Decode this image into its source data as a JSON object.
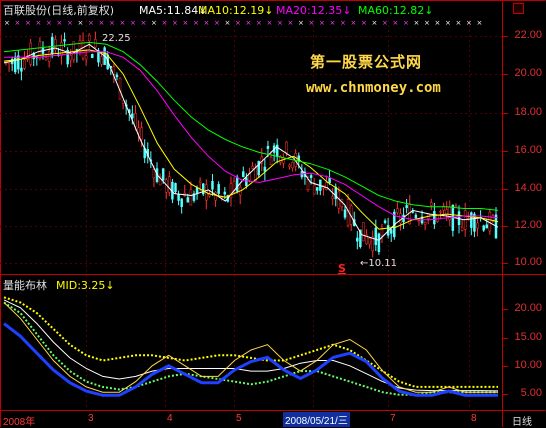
{
  "header": {
    "stock_name": "百联股份(日线,前复权)",
    "ma5": "MA5:11.84↓",
    "ma10": "MA10:12.19↓",
    "ma20": "MA20:12.35↓",
    "ma60": "MA60:12.82↓"
  },
  "watermark": {
    "line1": "第一股票公式网",
    "line2": "www.chnmoney.com"
  },
  "price_panel": {
    "high_label": "22.25",
    "low_label": "←10.11",
    "signal_mark": "S",
    "y_ticks": [
      "22.00",
      "20.00",
      "18.00",
      "16.00",
      "14.00",
      "12.00",
      "10.00"
    ]
  },
  "indicator_panel": {
    "name": "量能布林",
    "mid": "MID:3.25↓",
    "y_ticks": [
      "20.00",
      "15.00",
      "10.00",
      "5.00"
    ]
  },
  "x_axis": {
    "labels": [
      "2008年",
      "3",
      "4",
      "5",
      "2008/05/21/三",
      "7",
      "8"
    ],
    "period": "日线"
  },
  "colors": {
    "axis_red": "#c00000",
    "ma5": "#ffffff",
    "ma10": "#ffff00",
    "ma20": "#ff00ff",
    "ma60": "#00ff00",
    "candle_up": "#ff3030",
    "candle_down": "#54ffff"
  },
  "chart_data": {
    "type": "line",
    "title": "百联股份(日线,前复权)",
    "ylim": [
      9.5,
      23
    ],
    "annotations": [
      "22.25",
      "←10.11"
    ],
    "series": [
      {
        "name": "MA5",
        "values": [
          20.7,
          20.9,
          21.3,
          21.5,
          21.2,
          21.7,
          21.0,
          18.8,
          16.6,
          14.7,
          13.7,
          13.6,
          13.9,
          13.3,
          14.4,
          15.3,
          16.2,
          15.6,
          14.3,
          14.0,
          13.1,
          11.5,
          11.2,
          12.1,
          12.8,
          12.6,
          12.5,
          12.3,
          12.4,
          11.9
        ]
      },
      {
        "name": "MA10",
        "values": [
          20.8,
          20.9,
          21.1,
          21.2,
          21.3,
          21.4,
          21.2,
          20.1,
          18.3,
          16.4,
          15.0,
          14.2,
          13.7,
          13.5,
          13.9,
          14.6,
          15.4,
          15.7,
          15.1,
          14.3,
          13.7,
          12.7,
          11.8,
          11.9,
          12.3,
          12.5,
          12.6,
          12.5,
          12.4,
          12.2
        ]
      },
      {
        "name": "MA20",
        "values": [
          21.0,
          21.0,
          21.0,
          21.1,
          21.2,
          21.3,
          21.3,
          21.0,
          20.3,
          19.2,
          17.9,
          16.7,
          15.7,
          14.9,
          14.4,
          14.3,
          14.5,
          14.7,
          14.8,
          14.6,
          14.2,
          13.6,
          13.0,
          12.5,
          12.3,
          12.3,
          12.4,
          12.5,
          12.5,
          12.4
        ]
      },
      {
        "name": "MA60",
        "values": [
          21.3,
          21.4,
          21.5,
          21.6,
          21.7,
          21.8,
          21.7,
          21.3,
          20.6,
          19.7,
          18.7,
          17.8,
          17.1,
          16.6,
          16.2,
          15.9,
          15.7,
          15.5,
          15.3,
          15.0,
          14.6,
          14.1,
          13.6,
          13.3,
          13.1,
          13.0,
          13.0,
          12.9,
          12.9,
          12.8
        ]
      }
    ]
  }
}
